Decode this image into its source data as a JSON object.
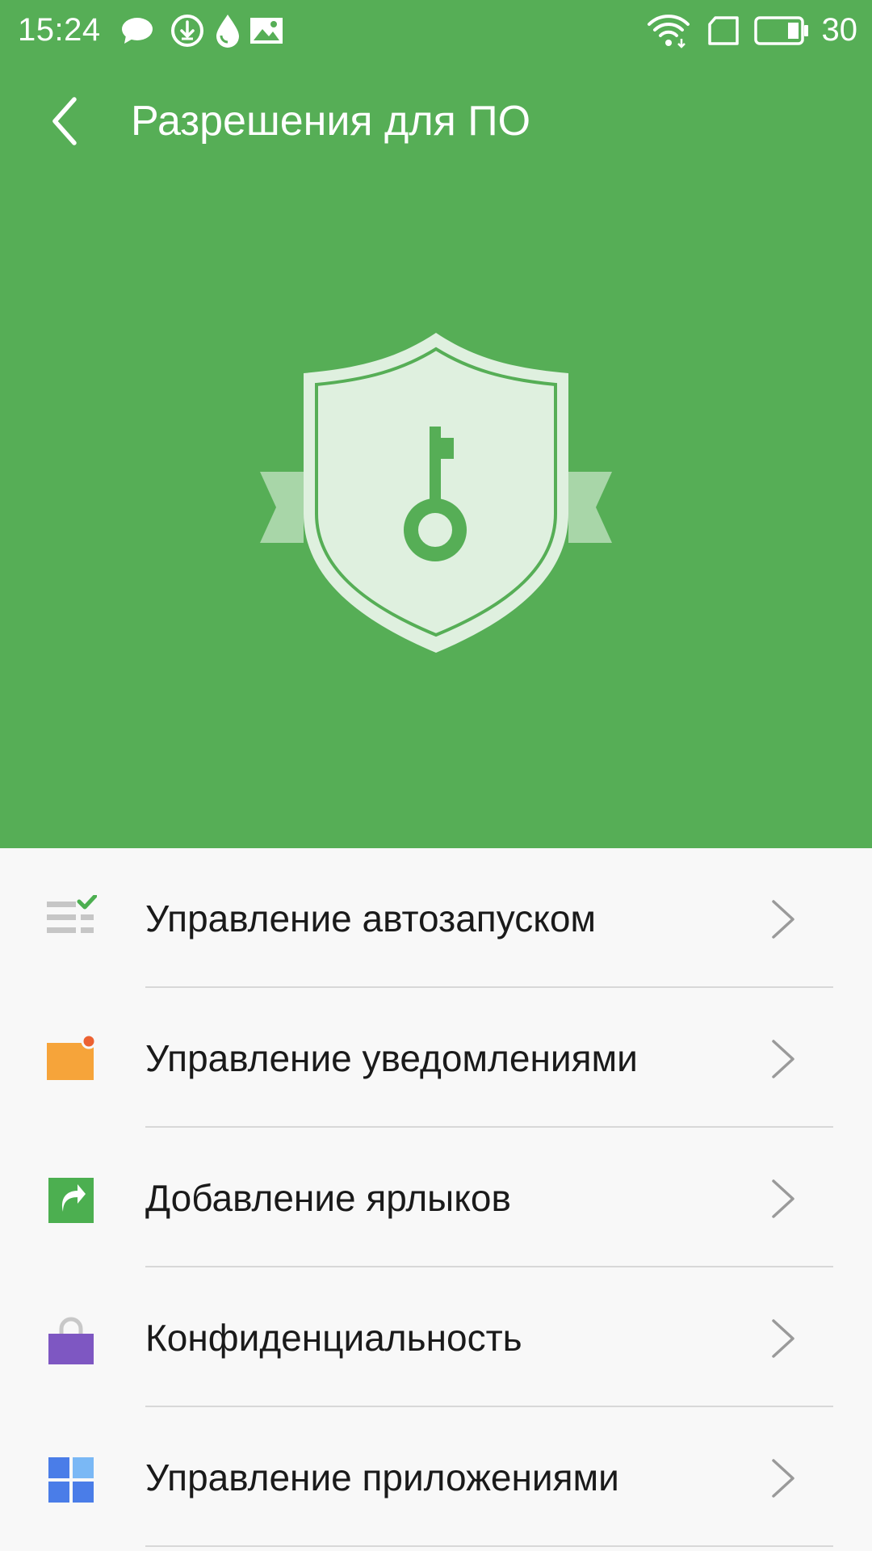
{
  "status_bar": {
    "time": "15:24",
    "battery_percent": "30",
    "left_icons": [
      "chat-bubble-icon",
      "download-icon",
      "water-drop-icon",
      "image-icon"
    ],
    "right_icons": [
      "wifi-icon",
      "sim-card-icon",
      "battery-icon"
    ]
  },
  "toolbar": {
    "back_icon": "chevron-left-icon",
    "title": "Разрешения для ПО"
  },
  "hero": {
    "icon": "shield-key-icon"
  },
  "menu": {
    "items": [
      {
        "label": "Управление автозапуском",
        "icon": "autostart-list-icon"
      },
      {
        "label": "Управление уведомлениями",
        "icon": "notification-icon"
      },
      {
        "label": "Добавление ярлыков",
        "icon": "shortcut-icon"
      },
      {
        "label": "Конфиденциальность",
        "icon": "privacy-lock-icon"
      },
      {
        "label": "Управление приложениями",
        "icon": "apps-grid-icon"
      }
    ]
  },
  "colors": {
    "header_green": "#56ae56",
    "shield_fill": "#dff0df",
    "ribbon": "#a8d6a8",
    "list_background": "#f8f8f8",
    "divider": "#d8d8d8",
    "chevron": "#9a9a9a"
  }
}
